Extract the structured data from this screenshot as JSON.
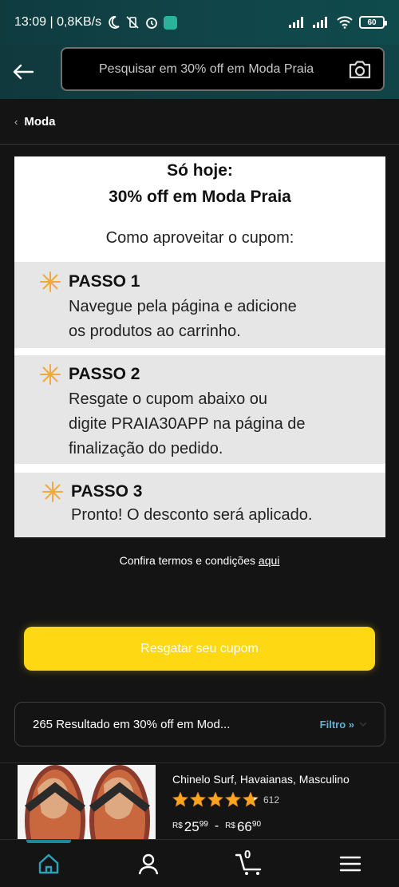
{
  "status_bar": {
    "time_speed": "13:09 | 0,8KB/s",
    "battery": "60"
  },
  "header": {
    "search_placeholder": "Pesquisar em 30% off em Moda Praia"
  },
  "breadcrumb": {
    "label": "Moda"
  },
  "promo": {
    "line1": "Só hoje:",
    "line2": "30% off em Moda Praia",
    "line3": "Como aproveitar o cupom:",
    "steps": [
      {
        "title": "PASSO 1",
        "body_line1": "Navegue pela página e adicione",
        "body_line2": "os produtos ao carrinho."
      },
      {
        "title": "PASSO 2",
        "body_line1": "Resgate o cupom abaixo ou",
        "body_line2": "digite PRAIA30APP na página de",
        "body_line3": "finalização do pedido."
      },
      {
        "title": "PASSO 3",
        "body_line1": "Pronto! O desconto será aplicado."
      }
    ]
  },
  "terms": {
    "text": "Confira termos e condições ",
    "link": "aqui"
  },
  "cta": {
    "label": "Resgatar seu cupom"
  },
  "results": {
    "count_text": "265 Resultado em 30% off em Mod...",
    "filter_label": "Filtro »"
  },
  "product": {
    "name": "Chinelo Surf, Havaianas, Masculino",
    "rating_count": "612",
    "rating": 4.5,
    "currency": "R$",
    "price_min_int": "25",
    "price_min_cents": "99",
    "price_max_int": "66",
    "price_max_cents": "90",
    "separator": "-"
  },
  "bottom_nav": {
    "cart_count": "0",
    "items": [
      "home-icon",
      "account-icon",
      "cart-icon",
      "menu-icon"
    ]
  },
  "colors": {
    "accent_button": "#ffd814",
    "header_teal": "#114447",
    "link_blue": "#5fb3d3",
    "star": "#ffa41c"
  }
}
